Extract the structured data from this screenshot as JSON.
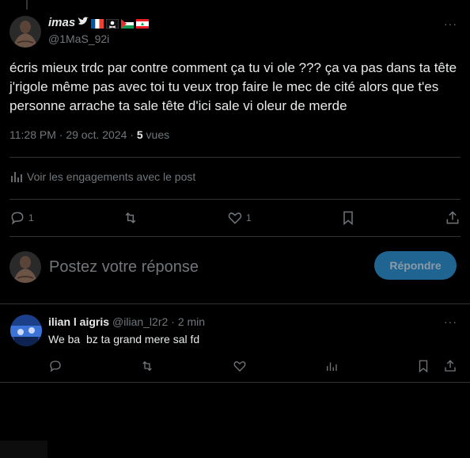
{
  "post": {
    "display_name": "imas",
    "handle": "@1MaS_92i",
    "text": "écris mieux trdc par contre comment ça tu vi ole ??? ça va pas dans ta tête j'rigole même pas avec toi tu veux trop faire le mec de cité alors que t'es personne arrache ta sale tête d'ici sale vi oleur de merde",
    "time": "11:28 PM · 29 oct. 2024 · ",
    "views_count": "5",
    "views_label": " vues",
    "more": "···"
  },
  "engagements_label": "Voir les engagements avec le post",
  "actions": {
    "reply_count": "1",
    "like_count": "1"
  },
  "reply_box": {
    "placeholder": "Postez votre réponse",
    "button_label": "Répondre"
  },
  "reply": {
    "display_name": "ilian l aigris",
    "handle": "@ilian_l2r2",
    "time": "· 2 min",
    "text": "We ba  bz ta grand mere sal fd",
    "more": "···"
  },
  "colors": {
    "background": "#000000",
    "text": "#e7e9ea",
    "muted": "#71767b",
    "divider": "#2f3336",
    "reply_button": "#206592"
  }
}
